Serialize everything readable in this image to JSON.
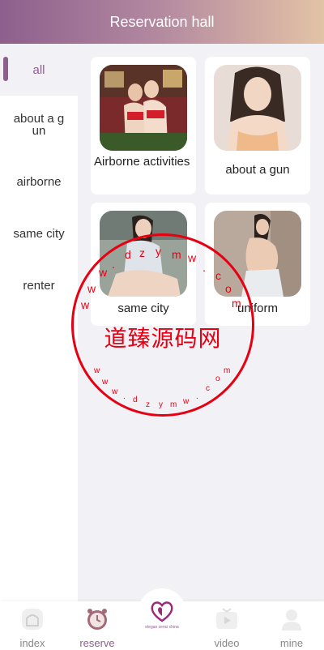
{
  "header": {
    "title": "Reservation hall"
  },
  "sidebar": {
    "items": [
      {
        "label": "all",
        "active": true
      },
      {
        "label": "about a gun",
        "active": false
      },
      {
        "label": "airborne",
        "active": false
      },
      {
        "label": "same city",
        "active": false
      },
      {
        "label": "renter",
        "active": false
      }
    ]
  },
  "cards": [
    {
      "title": "Airborne activities"
    },
    {
      "title": "about a gun"
    },
    {
      "title": "same city"
    },
    {
      "title": "uniform"
    }
  ],
  "watermark": {
    "text": "道臻源码网",
    "url_chars": [
      "w",
      "w",
      "w",
      ".",
      "d",
      "z",
      "y",
      "m",
      "w",
      ".",
      "c",
      "o",
      "m"
    ]
  },
  "tabbar": {
    "items": [
      {
        "label": "index",
        "icon": "home-icon",
        "active": false
      },
      {
        "label": "reserve",
        "icon": "alarm-clock-icon",
        "active": true
      },
      {
        "label": "video",
        "icon": "tv-icon",
        "active": false
      },
      {
        "label": "mine",
        "icon": "user-icon",
        "active": false
      }
    ],
    "center_logo_text": "elegan zenci china"
  },
  "colors": {
    "accent": "#8d5f8d",
    "background": "#f2f1f5",
    "watermark_red": "#e60012"
  }
}
